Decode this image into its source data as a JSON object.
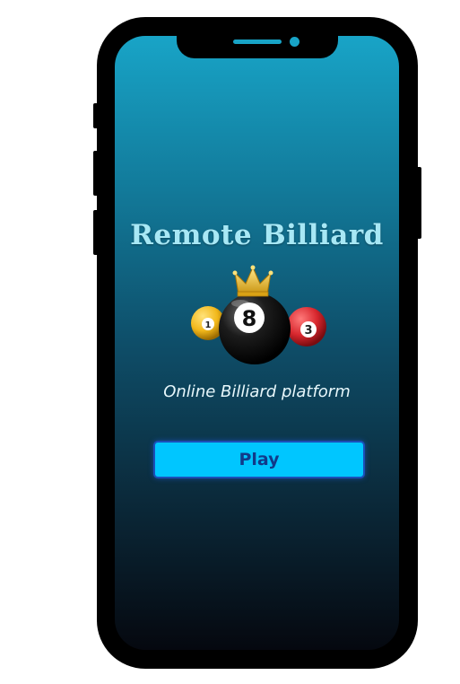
{
  "app": {
    "title": "Remote Billiard",
    "tagline": "Online Billiard platform",
    "play_label": "Play"
  },
  "logo": {
    "icon": "billiard-balls-crown-icon",
    "balls": [
      {
        "number": "1",
        "color": "#f2b81b"
      },
      {
        "number": "8",
        "color": "#111111"
      },
      {
        "number": "3",
        "color": "#d7262d"
      }
    ]
  },
  "colors": {
    "accent": "#00c6ff",
    "button_border": "#1b4fb8",
    "title": "#a8e8f5"
  }
}
